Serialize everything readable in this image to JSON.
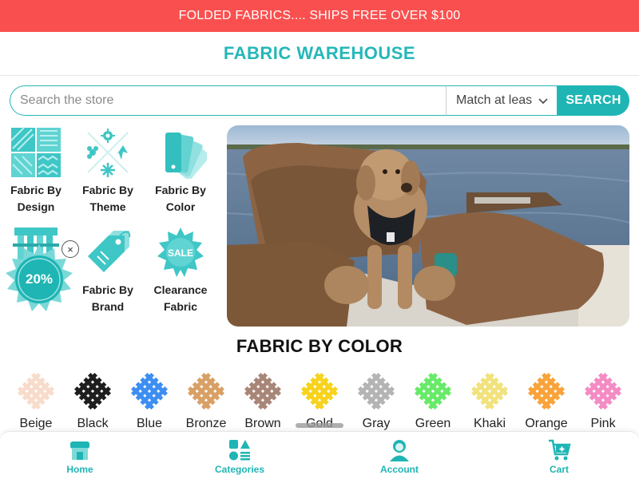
{
  "promo": {
    "text": "FOLDED FABRICS.... SHIPS FREE OVER $100"
  },
  "header": {
    "title": "FABRIC WAREHOUSE"
  },
  "search": {
    "placeholder": "Search the store",
    "match_value": "Match at leas",
    "button_label": "SEARCH"
  },
  "categories": [
    {
      "line1": "Fabric By",
      "line2": "Design",
      "icon": "design-icon"
    },
    {
      "line1": "Fabric By",
      "line2": "Theme",
      "icon": "theme-icon"
    },
    {
      "line1": "Fabric By",
      "line2": "Color",
      "icon": "color-icon"
    },
    {
      "line1": "",
      "line2": "",
      "icon": "bolts-icon"
    },
    {
      "line1": "Fabric By",
      "line2": "Brand",
      "icon": "tag-icon"
    },
    {
      "line1": "Clearance",
      "line2": "Fabric",
      "icon": "sale-icon"
    }
  ],
  "sale_badge": {
    "label": "SALE"
  },
  "discount": {
    "text": "20%",
    "close_glyph": "×"
  },
  "color_section": {
    "title": "FABRIC BY COLOR"
  },
  "colors": [
    {
      "label": "Beige",
      "hex": "#f8dccb"
    },
    {
      "label": "Black",
      "hex": "#1e1e1e"
    },
    {
      "label": "Blue",
      "hex": "#3d8ef2"
    },
    {
      "label": "Bronze",
      "hex": "#d9a065"
    },
    {
      "label": "Brown",
      "hex": "#a88677"
    },
    {
      "label": "Gold",
      "hex": "#f7d31d"
    },
    {
      "label": "Gray",
      "hex": "#b4b4b4"
    },
    {
      "label": "Green",
      "hex": "#68ea69"
    },
    {
      "label": "Khaki",
      "hex": "#f2e27e"
    },
    {
      "label": "Orange",
      "hex": "#f9a33a"
    },
    {
      "label": "Pink",
      "hex": "#f48bc4"
    }
  ],
  "nav": {
    "home": "Home",
    "categories": "Categories",
    "account": "Account",
    "cart": "Cart"
  },
  "colors_theme": {
    "accent": "#25b7b8",
    "promo": "#f9504f"
  }
}
